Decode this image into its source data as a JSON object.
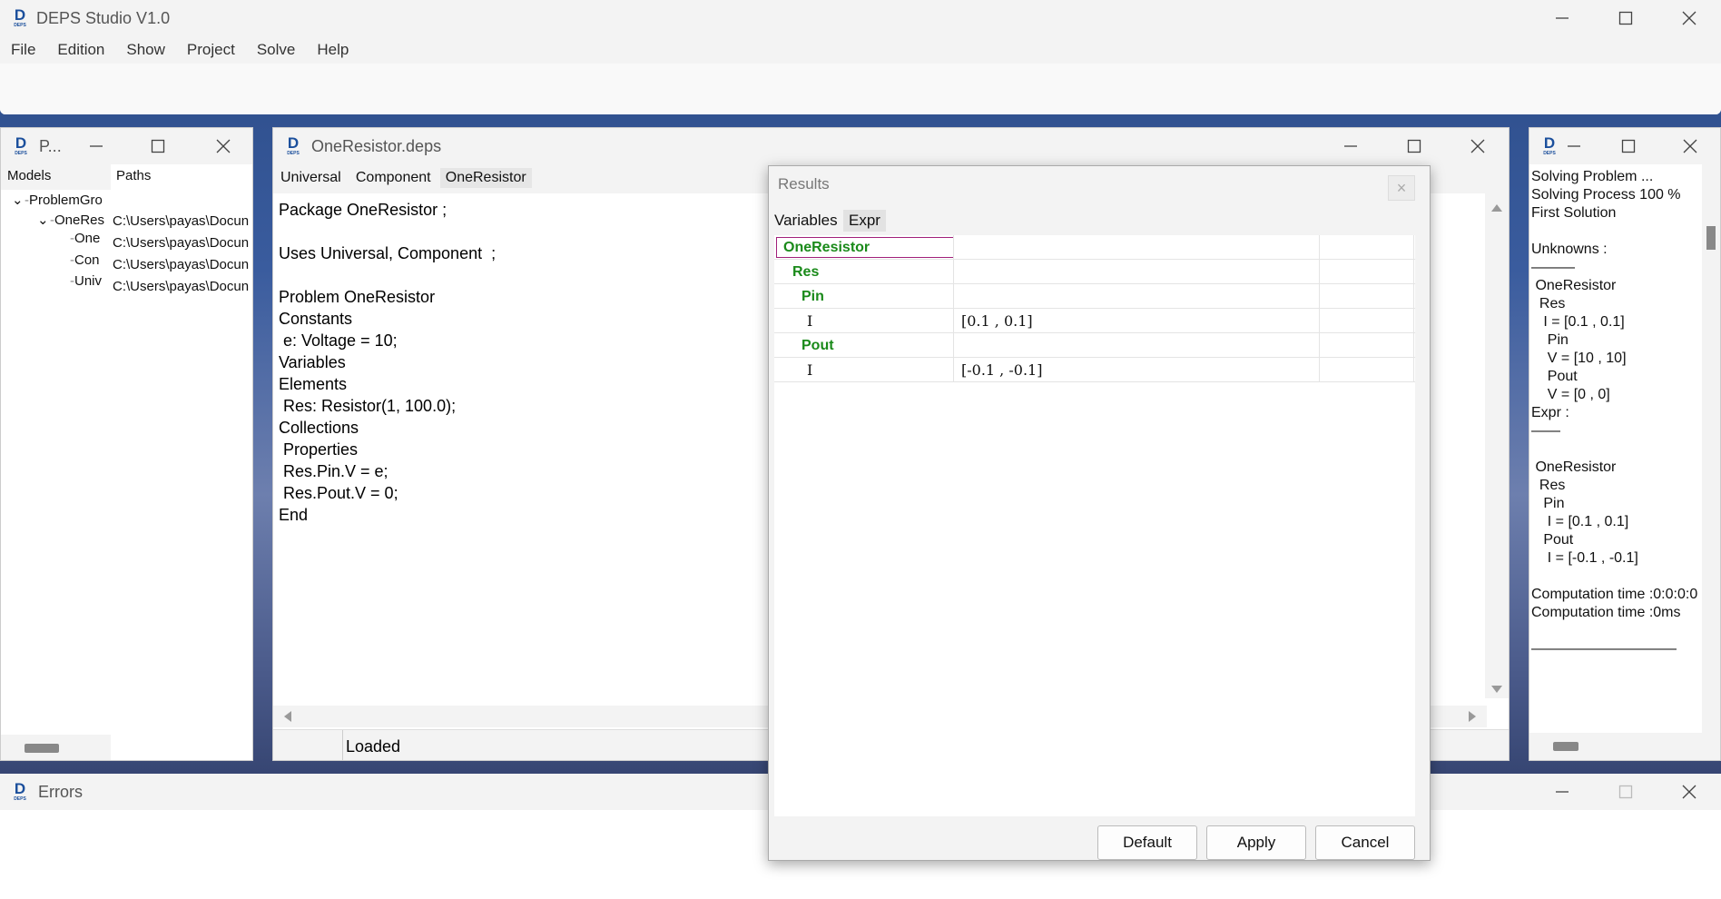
{
  "main": {
    "title": "DEPS Studio V1.0",
    "menu": [
      "File",
      "Edition",
      "Show",
      "Project",
      "Solve",
      "Help"
    ]
  },
  "project_panel": {
    "title": "P...",
    "columns": [
      "Models",
      "Paths"
    ],
    "tree": [
      {
        "label": "ProblemGro",
        "path": ""
      },
      {
        "label": "OneRes",
        "path": "C:\\Users\\payas\\Docun"
      },
      {
        "label": "One",
        "path": "C:\\Users\\payas\\Docun"
      },
      {
        "label": "Con",
        "path": "C:\\Users\\payas\\Docun"
      },
      {
        "label": "Univ",
        "path": "C:\\Users\\payas\\Docun"
      }
    ]
  },
  "editor": {
    "title": "OneResistor.deps",
    "tabs": [
      "Universal",
      "Component",
      "OneResistor"
    ],
    "code": "Package OneResistor ;\n\nUses Universal, Component  ;\n\nProblem OneResistor\nConstants\n e: Voltage = 10;\nVariables\nElements\n Res: Resistor(1, 100.0);\nCollections\n Properties\n Res.Pin.V = e;\n Res.Pout.V = 0;\nEnd",
    "status": "Loaded"
  },
  "results": {
    "title": "Results",
    "close": "×",
    "tabs": [
      "Variables",
      "Expr"
    ],
    "rows": [
      {
        "name": "OneResistor",
        "value": "",
        "kind": "node"
      },
      {
        "name": "Res",
        "value": "",
        "kind": "node"
      },
      {
        "name": "Pin",
        "value": "",
        "kind": "node"
      },
      {
        "name": "I",
        "value": "[0.1 , 0.1]",
        "kind": "var"
      },
      {
        "name": "Pout",
        "value": "",
        "kind": "node"
      },
      {
        "name": "I",
        "value": "[-0.1 , -0.1]",
        "kind": "var"
      }
    ],
    "buttons": [
      "Default",
      "Apply",
      "Cancel"
    ]
  },
  "output": {
    "text": "Solving Problem ...\nSolving Process 100 %\nFirst Solution\n\nUnknowns :\n———\n OneResistor\n  Res\n   I = [0.1 , 0.1]\n    Pin\n    V = [10 , 10]\n    Pout\n    V = [0 , 0]\nExpr :\n——\n\n OneResistor\n  Res\n   Pin\n    I = [0.1 , 0.1]\n   Pout\n    I = [-0.1 , -0.1]\n\nComputation time :0:0:0:0\nComputation time :0ms\n\n——————————"
  },
  "errors": {
    "title": "Errors"
  },
  "icons": {
    "app_logo": "deps-logo-icon",
    "minimize": "minimize-icon",
    "maximize": "maximize-icon",
    "close": "close-icon"
  },
  "colors": {
    "tree_node_green": "#1a8a1a",
    "selection_border": "#a0207a",
    "logo_blue": "#1b4f9c"
  }
}
